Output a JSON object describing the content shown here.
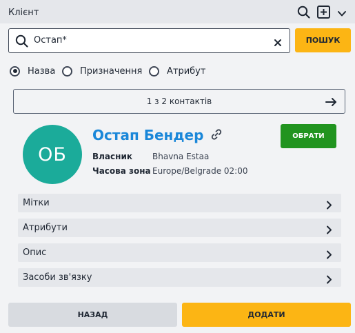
{
  "header": {
    "title": "Клієнт",
    "icons": [
      "search-icon",
      "add-square-icon",
      "chevron-down-icon"
    ]
  },
  "search": {
    "value": "Остап*",
    "button_label": "ПОШУК"
  },
  "search_mode": {
    "options": [
      {
        "label": "Назва",
        "checked": true
      },
      {
        "label": "Призначення",
        "checked": false
      },
      {
        "label": "Атрибут",
        "checked": false
      }
    ]
  },
  "results": {
    "pager_text": "1 з 2 контактів"
  },
  "contact": {
    "initials": "ОБ",
    "name": "Остап Бендер",
    "select_label": "ОБРАТИ",
    "owner_label": "Власник",
    "owner_value": "Bhavna Estaa",
    "timezone_label": "Часова зона",
    "timezone_value": "Europe/Belgrade 02:00"
  },
  "sections": [
    {
      "label": "Мітки"
    },
    {
      "label": "Атрибути"
    },
    {
      "label": "Опис"
    },
    {
      "label": "Засоби зв'язку"
    }
  ],
  "footer": {
    "back_label": "НАЗАД",
    "add_label": "ДОДАТИ"
  },
  "colors": {
    "accent_yellow": "#fcb514",
    "select_green": "#21941f",
    "avatar_teal": "#1bab9a",
    "link_blue": "#1a87d9"
  }
}
